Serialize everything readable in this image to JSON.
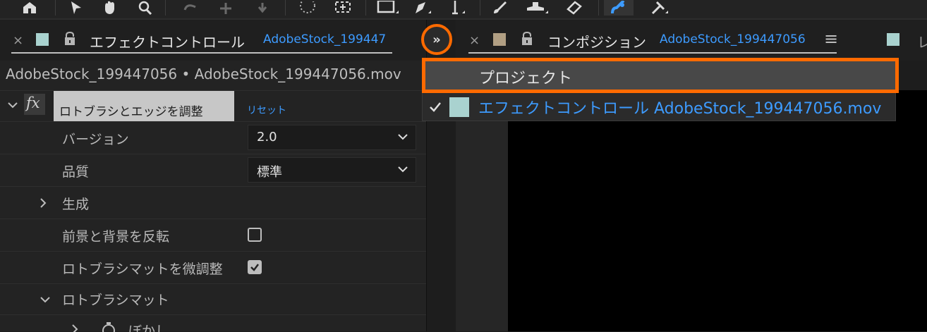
{
  "left_panel": {
    "tab_close": "×",
    "tab_title": "エフェクトコントロール",
    "tab_link": "AdobeStock_199447",
    "subtitle": "AdobeStock_199447056 • AdobeStock_199447056.mov",
    "effect": {
      "fx_label": "fx",
      "name": "ロトブラシとエッジを調整",
      "reset": "リセット"
    },
    "properties": [
      {
        "label": "バージョン",
        "value": "2.0"
      },
      {
        "label": "品質",
        "value": "標準"
      },
      {
        "label": "生成"
      },
      {
        "label": "前景と背景を反転",
        "checked": false
      },
      {
        "label": "ロトブラシマットを微調整",
        "checked": true
      },
      {
        "label": "ロトブラシマット"
      },
      {
        "label": "ぼかし"
      }
    ]
  },
  "right_panel": {
    "tab_close": "×",
    "tab_title": "コンポジション",
    "tab_link": "AdobeStock_199447056",
    "menu_icon": "≡",
    "next_tab_partial": "レ"
  },
  "overflow_button": {
    "label": "»"
  },
  "overflow_menu": {
    "items": [
      {
        "label": "プロジェクト",
        "highlighted": true
      },
      {
        "label": "エフェクトコントロール AdobeStock_199447056.mov",
        "checked": true
      }
    ]
  },
  "colors": {
    "accent_blue": "#3d9bff",
    "highlight_orange": "#ff6a00",
    "swatch_teal": "#a9d2cf",
    "swatch_tan": "#b19f83"
  }
}
